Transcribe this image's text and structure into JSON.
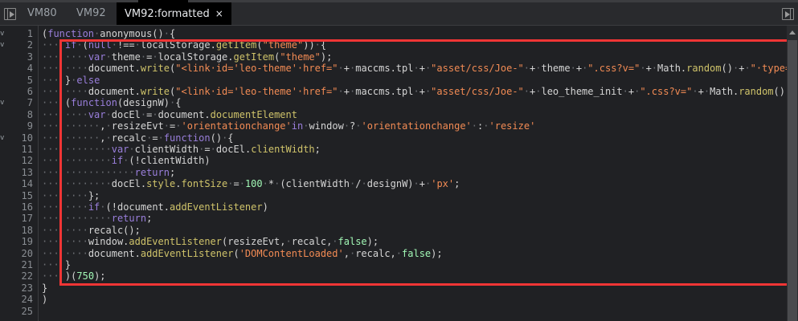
{
  "tabs": [
    {
      "label": "VM80",
      "active": false
    },
    {
      "label": "VM92",
      "active": false
    },
    {
      "label": "VM92:formatted",
      "active": true,
      "close": "×"
    }
  ],
  "colors": {
    "keyword": "#9a7fdc",
    "string": "#f28b54",
    "method": "#cfc36a",
    "number": "#a1f7b5",
    "plain": "#d5d5d5",
    "highlight": "#f03535"
  },
  "icons": {
    "left": "toggle-navigator-icon",
    "right": "toggle-debugger-icon",
    "fold": "fold-arrow-icon"
  },
  "fold_markers": [
    1,
    2,
    7,
    10
  ],
  "fold_glyph": "v",
  "lines": [
    [
      [
        "p",
        "("
      ],
      [
        "k",
        "function"
      ],
      [
        "d",
        "·"
      ],
      [
        "p",
        "anonymous()"
      ],
      [
        "d",
        "·"
      ],
      [
        "p",
        "{"
      ]
    ],
    [
      [
        "d",
        "···"
      ],
      [
        "p",
        " "
      ],
      [
        "k",
        "if"
      ],
      [
        "d",
        "·"
      ],
      [
        "p",
        "("
      ],
      [
        "k",
        "null"
      ],
      [
        "d",
        "·"
      ],
      [
        "p",
        "!=="
      ],
      [
        "d",
        "·"
      ],
      [
        "p",
        "localStorage."
      ],
      [
        "m",
        "getItem"
      ],
      [
        "p",
        "("
      ],
      [
        "s",
        "\"theme\""
      ],
      [
        "p",
        "))"
      ],
      [
        "d",
        "·"
      ],
      [
        "p",
        "{"
      ]
    ],
    [
      [
        "d",
        "···"
      ],
      [
        "p",
        " "
      ],
      [
        "d",
        "····"
      ],
      [
        "k",
        "var"
      ],
      [
        "d",
        "·"
      ],
      [
        "p",
        "theme"
      ],
      [
        "d",
        "·"
      ],
      [
        "p",
        "="
      ],
      [
        "d",
        "·"
      ],
      [
        "p",
        "localStorage."
      ],
      [
        "m",
        "getItem"
      ],
      [
        "p",
        "("
      ],
      [
        "s",
        "\"theme\""
      ],
      [
        "p",
        ");"
      ]
    ],
    [
      [
        "d",
        "···"
      ],
      [
        "p",
        " "
      ],
      [
        "d",
        "····"
      ],
      [
        "p",
        "document."
      ],
      [
        "m",
        "write"
      ],
      [
        "p",
        "("
      ],
      [
        "s",
        "\"<link·id='leo-theme'·href=\""
      ],
      [
        "d",
        "·"
      ],
      [
        "p",
        "+"
      ],
      [
        "d",
        "·"
      ],
      [
        "p",
        "maccms.tpl"
      ],
      [
        "d",
        "·"
      ],
      [
        "p",
        "+"
      ],
      [
        "d",
        "·"
      ],
      [
        "s",
        "\"asset/css/Joe-\""
      ],
      [
        "d",
        "·"
      ],
      [
        "p",
        "+"
      ],
      [
        "d",
        "·"
      ],
      [
        "p",
        "theme"
      ],
      [
        "d",
        "·"
      ],
      [
        "p",
        "+"
      ],
      [
        "d",
        "·"
      ],
      [
        "s",
        "\".css?v=\""
      ],
      [
        "d",
        "·"
      ],
      [
        "p",
        "+"
      ],
      [
        "d",
        "·"
      ],
      [
        "p",
        "Math."
      ],
      [
        "m",
        "random"
      ],
      [
        "p",
        "()"
      ],
      [
        "d",
        "·"
      ],
      [
        "p",
        "+"
      ],
      [
        "d",
        "·"
      ],
      [
        "s",
        "\"·type='text/css'·rel='stylesheet'>\""
      ]
    ],
    [
      [
        "d",
        "···"
      ],
      [
        "p",
        " "
      ],
      [
        "p",
        "}"
      ],
      [
        "d",
        "·"
      ],
      [
        "k",
        "else"
      ]
    ],
    [
      [
        "d",
        "···"
      ],
      [
        "p",
        " "
      ],
      [
        "d",
        "····"
      ],
      [
        "p",
        "document."
      ],
      [
        "m",
        "write"
      ],
      [
        "p",
        "("
      ],
      [
        "s",
        "\"<link·id='leo-theme'·href=\""
      ],
      [
        "d",
        "·"
      ],
      [
        "p",
        "+"
      ],
      [
        "d",
        "·"
      ],
      [
        "p",
        "maccms.tpl"
      ],
      [
        "d",
        "·"
      ],
      [
        "p",
        "+"
      ],
      [
        "d",
        "·"
      ],
      [
        "s",
        "\"asset/css/Joe-\""
      ],
      [
        "d",
        "·"
      ],
      [
        "p",
        "+"
      ],
      [
        "d",
        "·"
      ],
      [
        "p",
        "leo_theme_init"
      ],
      [
        "d",
        "·"
      ],
      [
        "p",
        "+"
      ],
      [
        "d",
        "·"
      ],
      [
        "s",
        "\".css?v=\""
      ],
      [
        "d",
        "·"
      ],
      [
        "p",
        "+"
      ],
      [
        "d",
        "·"
      ],
      [
        "p",
        "Math."
      ],
      [
        "m",
        "random"
      ],
      [
        "p",
        "()"
      ],
      [
        "d",
        "·"
      ],
      [
        "p",
        "+"
      ],
      [
        "d",
        "·"
      ],
      [
        "s",
        "\"··type='text/css'·rel='stylesheet'>\""
      ]
    ],
    [
      [
        "d",
        "···"
      ],
      [
        "p",
        " "
      ],
      [
        "p",
        "("
      ],
      [
        "k",
        "function"
      ],
      [
        "p",
        "(designW)"
      ],
      [
        "d",
        "·"
      ],
      [
        "p",
        "{"
      ]
    ],
    [
      [
        "d",
        "···"
      ],
      [
        "p",
        " "
      ],
      [
        "d",
        "····"
      ],
      [
        "k",
        "var"
      ],
      [
        "d",
        "·"
      ],
      [
        "p",
        "docEl"
      ],
      [
        "d",
        "·"
      ],
      [
        "p",
        "="
      ],
      [
        "d",
        "·"
      ],
      [
        "p",
        "document."
      ],
      [
        "m",
        "documentElement"
      ]
    ],
    [
      [
        "d",
        "···"
      ],
      [
        "p",
        " "
      ],
      [
        "d",
        "······"
      ],
      [
        "p",
        ","
      ],
      [
        "d",
        "·"
      ],
      [
        "p",
        "resizeEvt"
      ],
      [
        "d",
        "·"
      ],
      [
        "p",
        "="
      ],
      [
        "d",
        "·"
      ],
      [
        "s",
        "'orientationchange'"
      ],
      [
        "k",
        "in"
      ],
      [
        "d",
        "·"
      ],
      [
        "p",
        "window"
      ],
      [
        "d",
        "·"
      ],
      [
        "p",
        "?"
      ],
      [
        "d",
        "·"
      ],
      [
        "s",
        "'orientationchange'"
      ],
      [
        "d",
        "·"
      ],
      [
        "p",
        ":"
      ],
      [
        "d",
        "·"
      ],
      [
        "s",
        "'resize'"
      ]
    ],
    [
      [
        "d",
        "···"
      ],
      [
        "p",
        " "
      ],
      [
        "d",
        "······"
      ],
      [
        "p",
        ","
      ],
      [
        "d",
        "·"
      ],
      [
        "p",
        "recalc"
      ],
      [
        "d",
        "·"
      ],
      [
        "p",
        "="
      ],
      [
        "d",
        "·"
      ],
      [
        "k",
        "function"
      ],
      [
        "p",
        "()"
      ],
      [
        "d",
        "·"
      ],
      [
        "p",
        "{"
      ]
    ],
    [
      [
        "d",
        "···"
      ],
      [
        "p",
        " "
      ],
      [
        "d",
        "········"
      ],
      [
        "k",
        "var"
      ],
      [
        "d",
        "·"
      ],
      [
        "p",
        "clientWidth"
      ],
      [
        "d",
        "·"
      ],
      [
        "p",
        "="
      ],
      [
        "d",
        "·"
      ],
      [
        "p",
        "docEl."
      ],
      [
        "m",
        "clientWidth"
      ],
      [
        "p",
        ";"
      ]
    ],
    [
      [
        "d",
        "···"
      ],
      [
        "p",
        " "
      ],
      [
        "d",
        "········"
      ],
      [
        "k",
        "if"
      ],
      [
        "d",
        "·"
      ],
      [
        "p",
        "(!clientWidth)"
      ]
    ],
    [
      [
        "d",
        "···"
      ],
      [
        "p",
        " "
      ],
      [
        "d",
        "············"
      ],
      [
        "k",
        "return"
      ],
      [
        "p",
        ";"
      ]
    ],
    [
      [
        "d",
        "···"
      ],
      [
        "p",
        " "
      ],
      [
        "d",
        "········"
      ],
      [
        "p",
        "docEl."
      ],
      [
        "m",
        "style"
      ],
      [
        "p",
        "."
      ],
      [
        "m",
        "fontSize"
      ],
      [
        "d",
        "·"
      ],
      [
        "p",
        "="
      ],
      [
        "d",
        "·"
      ],
      [
        "n",
        "100"
      ],
      [
        "d",
        "·"
      ],
      [
        "p",
        "*"
      ],
      [
        "d",
        "·"
      ],
      [
        "p",
        "(clientWidth"
      ],
      [
        "d",
        "·"
      ],
      [
        "p",
        "/"
      ],
      [
        "d",
        "·"
      ],
      [
        "p",
        "designW)"
      ],
      [
        "d",
        "·"
      ],
      [
        "p",
        "+"
      ],
      [
        "d",
        "·"
      ],
      [
        "s",
        "'px'"
      ],
      [
        "p",
        ";"
      ]
    ],
    [
      [
        "d",
        "···"
      ],
      [
        "p",
        " "
      ],
      [
        "d",
        "····"
      ],
      [
        "p",
        "};"
      ]
    ],
    [
      [
        "d",
        "···"
      ],
      [
        "p",
        " "
      ],
      [
        "d",
        "····"
      ],
      [
        "k",
        "if"
      ],
      [
        "d",
        "·"
      ],
      [
        "p",
        "(!document."
      ],
      [
        "m",
        "addEventListener"
      ],
      [
        "p",
        ")"
      ]
    ],
    [
      [
        "d",
        "···"
      ],
      [
        "p",
        " "
      ],
      [
        "d",
        "········"
      ],
      [
        "k",
        "return"
      ],
      [
        "p",
        ";"
      ]
    ],
    [
      [
        "d",
        "···"
      ],
      [
        "p",
        " "
      ],
      [
        "d",
        "····"
      ],
      [
        "p",
        "recalc();"
      ]
    ],
    [
      [
        "d",
        "···"
      ],
      [
        "p",
        " "
      ],
      [
        "d",
        "····"
      ],
      [
        "p",
        "window."
      ],
      [
        "m",
        "addEventListener"
      ],
      [
        "p",
        "(resizeEvt,"
      ],
      [
        "d",
        "·"
      ],
      [
        "p",
        "recalc,"
      ],
      [
        "d",
        "·"
      ],
      [
        "n",
        "false"
      ],
      [
        "p",
        ");"
      ]
    ],
    [
      [
        "d",
        "···"
      ],
      [
        "p",
        " "
      ],
      [
        "d",
        "····"
      ],
      [
        "p",
        "document."
      ],
      [
        "m",
        "addEventListener"
      ],
      [
        "p",
        "("
      ],
      [
        "s",
        "'DOMContentLoaded'"
      ],
      [
        "p",
        ","
      ],
      [
        "d",
        "·"
      ],
      [
        "p",
        "recalc,"
      ],
      [
        "d",
        "·"
      ],
      [
        "n",
        "false"
      ],
      [
        "p",
        ");"
      ]
    ],
    [
      [
        "d",
        "···"
      ],
      [
        "p",
        " "
      ],
      [
        "p",
        "}"
      ]
    ],
    [
      [
        "d",
        "···"
      ],
      [
        "p",
        " "
      ],
      [
        "p",
        ")("
      ],
      [
        "n",
        "750"
      ],
      [
        "p",
        ");"
      ]
    ],
    [
      [
        "p",
        "}"
      ]
    ],
    [
      [
        "p",
        ")"
      ]
    ],
    []
  ]
}
